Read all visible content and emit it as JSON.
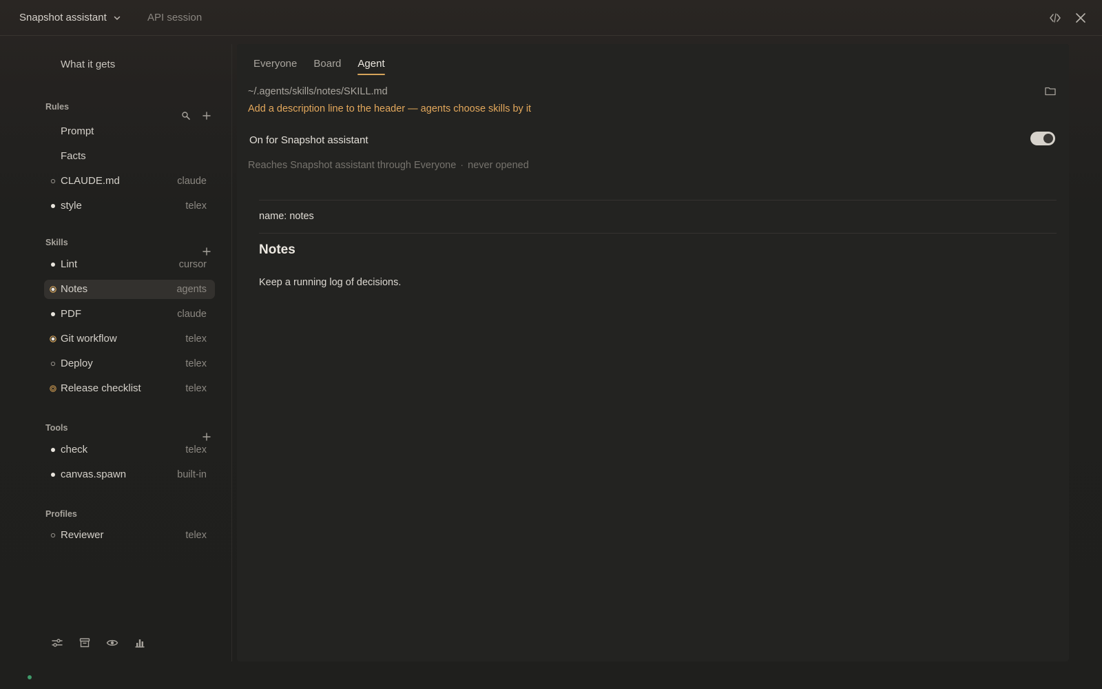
{
  "header": {
    "assistant_name": "Snapshot assistant",
    "session_label": "API session",
    "icons": [
      "chevron-down-icon",
      "code-icon",
      "close-icon"
    ]
  },
  "sidebar": {
    "what_it_gets": "What it gets",
    "rules": {
      "title": "Rules",
      "items": [
        {
          "label": "Prompt",
          "tag": "",
          "dot": "none"
        },
        {
          "label": "Facts",
          "tag": "",
          "dot": "none"
        },
        {
          "label": "CLAUDE.md",
          "tag": "claude",
          "dot": "hollow"
        },
        {
          "label": "style",
          "tag": "telex",
          "dot": "filled"
        }
      ]
    },
    "skills": {
      "title": "Skills",
      "items": [
        {
          "label": "Lint",
          "tag": "cursor",
          "dot": "filled"
        },
        {
          "label": "Notes",
          "tag": "agents",
          "dot": "ringed",
          "selected": true
        },
        {
          "label": "PDF",
          "tag": "claude",
          "dot": "filled"
        },
        {
          "label": "Git workflow",
          "tag": "telex",
          "dot": "ringed"
        },
        {
          "label": "Deploy",
          "tag": "telex",
          "dot": "hollow"
        },
        {
          "label": "Release checklist",
          "tag": "telex",
          "dot": "amber-ring"
        }
      ]
    },
    "tools": {
      "title": "Tools",
      "items": [
        {
          "label": "check",
          "tag": "telex",
          "dot": "filled"
        },
        {
          "label": "canvas.spawn",
          "tag": "built-in",
          "dot": "filled"
        }
      ]
    },
    "profiles": {
      "title": "Profiles",
      "items": [
        {
          "label": "Reviewer",
          "tag": "telex",
          "dot": "hollow"
        }
      ]
    },
    "bottom_icons": [
      "sliders-icon",
      "archive-icon",
      "eye-icon",
      "chart-icon"
    ]
  },
  "main": {
    "tabs": [
      {
        "label": "Everyone",
        "active": false
      },
      {
        "label": "Board",
        "active": false
      },
      {
        "label": "Agent",
        "active": true
      }
    ],
    "file_path": "~/.agents/skills/notes/SKILL.md",
    "hint": "Add a description line to the header — agents choose skills by it",
    "toggle_label": "On for Snapshot assistant",
    "toggle_on": true,
    "reach_text": "Reaches Snapshot assistant through Everyone",
    "reach_sep": "·",
    "reach_status": "never opened",
    "frontmatter_name": "name: notes",
    "doc_heading": "Notes",
    "doc_body": "Keep a running log of decisions."
  },
  "colors": {
    "accent": "#d6a45a",
    "hint": "#e3a85c",
    "status_online": "#3f9a6a"
  }
}
